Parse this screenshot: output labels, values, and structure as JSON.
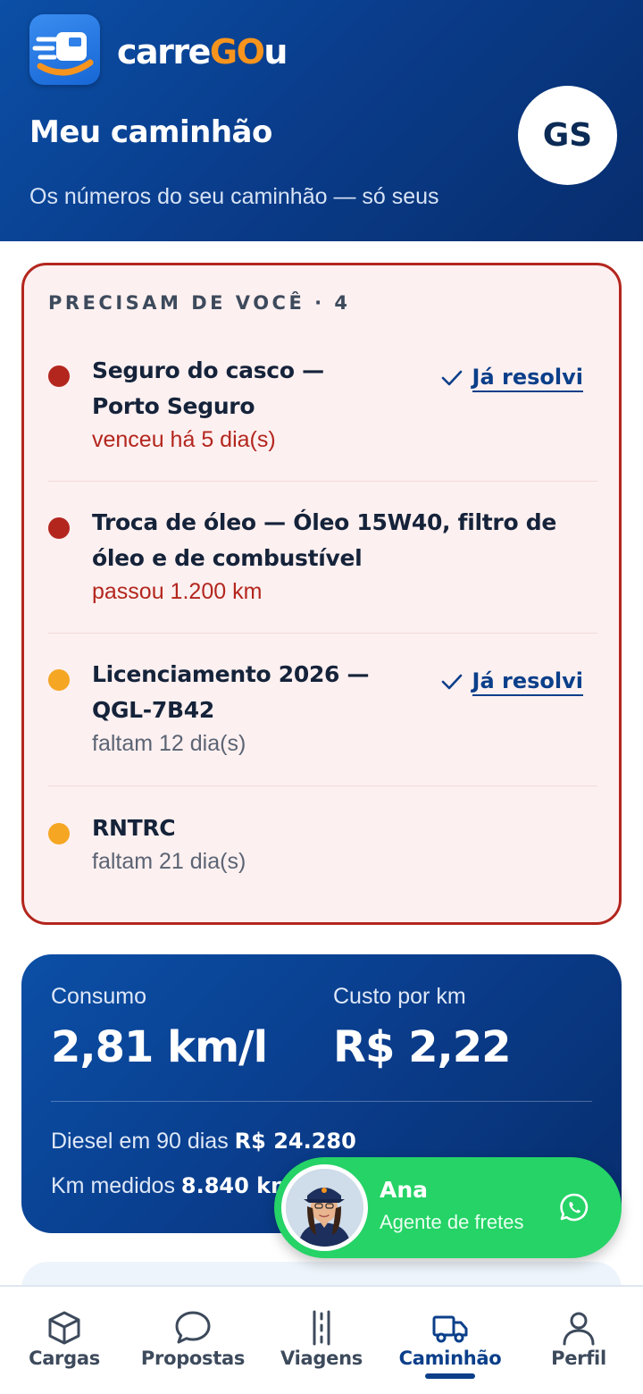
{
  "header": {
    "brand_prefix": "carre",
    "brand_highlight": "GO",
    "brand_suffix": "u",
    "title": "Meu caminhão",
    "subtitle": "Os números do seu caminhão — só seus",
    "avatar_initials": "GS"
  },
  "alerts": {
    "heading": "PRECISAM DE VOCÊ · 4",
    "items": [
      {
        "title": "Seguro do casco — Porto Seguro",
        "status": "venceu há 5 dia(s)",
        "severity": "red",
        "action": "Já resolvi"
      },
      {
        "title": "Troca de óleo — Óleo 15W40, filtro de óleo e de combustível",
        "status": "passou 1.200 km",
        "severity": "red"
      },
      {
        "title": "Licenciamento 2026 — QGL-7B42",
        "status": "faltam 12 dia(s)",
        "severity": "amber",
        "action": "Já resolvi"
      },
      {
        "title": "RNTRC",
        "status": "faltam 21 dia(s)",
        "severity": "amber"
      }
    ]
  },
  "stats": {
    "consumo_label": "Consumo",
    "consumo_value": "2,81 km/l",
    "custo_label": "Custo por km",
    "custo_value": "R$ 2,22",
    "diesel_label": "Diesel em 90 dias",
    "diesel_value": "R$ 24.280",
    "km_label": "Km medidos",
    "km_value": "8.840 km"
  },
  "agent": {
    "name": "Ana",
    "role": "Agente de fretes",
    "icon": "whatsapp-icon"
  },
  "nav": {
    "items": [
      {
        "label": "Cargas",
        "icon": "box-icon"
      },
      {
        "label": "Propostas",
        "icon": "chat-bubble-icon"
      },
      {
        "label": "Viagens",
        "icon": "road-icon"
      },
      {
        "label": "Caminhão",
        "icon": "truck-icon",
        "active": true
      },
      {
        "label": "Perfil",
        "icon": "person-icon"
      }
    ]
  },
  "colors": {
    "brand_blue": "#0a3d8c",
    "accent_orange": "#f7941d",
    "alert_red": "#b3261e",
    "alert_amber": "#f5a623",
    "whatsapp_green": "#25d366"
  }
}
